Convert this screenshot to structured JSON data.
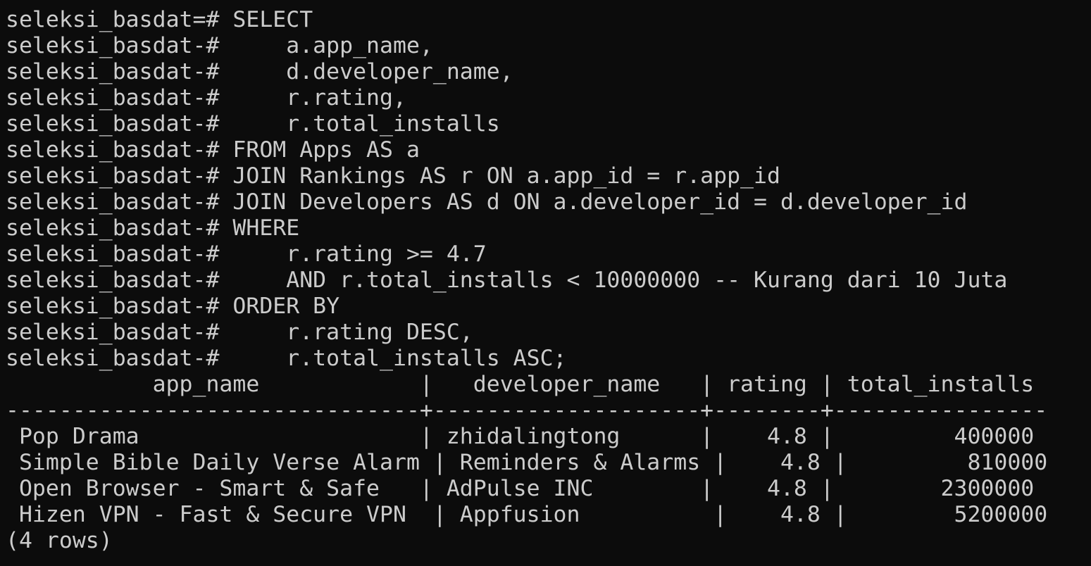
{
  "terminal": {
    "lines": [
      "seleksi_basdat=# SELECT",
      "seleksi_basdat-#     a.app_name,",
      "seleksi_basdat-#     d.developer_name,",
      "seleksi_basdat-#     r.rating,",
      "seleksi_basdat-#     r.total_installs",
      "seleksi_basdat-# FROM Apps AS a",
      "seleksi_basdat-# JOIN Rankings AS r ON a.app_id = r.app_id",
      "seleksi_basdat-# JOIN Developers AS d ON a.developer_id = d.developer_id",
      "seleksi_basdat-# WHERE",
      "seleksi_basdat-#     r.rating >= 4.7",
      "seleksi_basdat-#     AND r.total_installs < 10000000 -- Kurang dari 10 Juta",
      "seleksi_basdat-# ORDER BY",
      "seleksi_basdat-#     r.rating DESC,",
      "seleksi_basdat-#     r.total_installs ASC;",
      "           app_name            |   developer_name   | rating | total_installs",
      "-------------------------------+--------------------+--------+----------------",
      " Pop Drama                     | zhidalingtong      |    4.8 |         400000",
      " Simple Bible Daily Verse Alarm | Reminders & Alarms |    4.8 |         810000",
      " Open Browser - Smart & Safe   | AdPulse INC        |    4.8 |        2300000",
      " Hizen VPN - Fast & Secure VPN  | Appfusion          |    4.8 |        5200000",
      "(4 rows)"
    ]
  },
  "colors": {
    "background": "#0c0c0c",
    "text": "#cccccc"
  }
}
